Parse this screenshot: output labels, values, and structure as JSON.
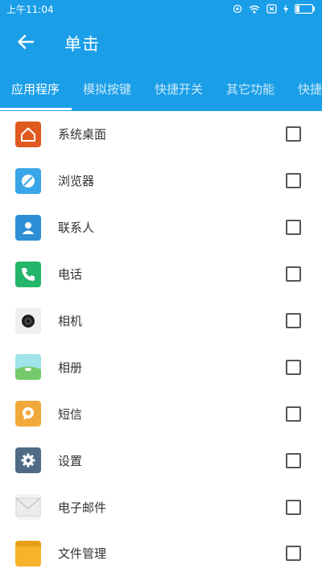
{
  "status_bar": {
    "time": "上午11:04"
  },
  "app_bar": {
    "title": "单击",
    "back_icon": "arrow-left-icon"
  },
  "colors": {
    "primary": "#1a9ee8"
  },
  "tabs": [
    {
      "label": "应用程序",
      "active": true
    },
    {
      "label": "模拟按键",
      "active": false
    },
    {
      "label": "快捷开关",
      "active": false
    },
    {
      "label": "其它功能",
      "active": false
    },
    {
      "label": "快捷",
      "active": false
    }
  ],
  "apps": [
    {
      "label": "系统桌面",
      "icon": "home-icon",
      "color": "#e05a1f",
      "checked": false
    },
    {
      "label": "浏览器",
      "icon": "browser-icon",
      "color": "#3aa6e8",
      "checked": false
    },
    {
      "label": "联系人",
      "icon": "contacts-icon",
      "color": "#2d8fd6",
      "checked": false
    },
    {
      "label": "电话",
      "icon": "phone-icon",
      "color": "#23b56a",
      "checked": false
    },
    {
      "label": "相机",
      "icon": "camera-icon",
      "color": "#efefef",
      "checked": false
    },
    {
      "label": "相册",
      "icon": "gallery-icon",
      "color": "#7fd0a0",
      "checked": false
    },
    {
      "label": "短信",
      "icon": "message-icon",
      "color": "#f2a93b",
      "checked": false
    },
    {
      "label": "设置",
      "icon": "settings-icon",
      "color": "#4f6b86",
      "checked": false
    },
    {
      "label": "电子邮件",
      "icon": "mail-icon",
      "color": "#e8e8e8",
      "checked": false
    },
    {
      "label": "文件管理",
      "icon": "folder-icon",
      "color": "#f7b32c",
      "checked": false
    }
  ]
}
